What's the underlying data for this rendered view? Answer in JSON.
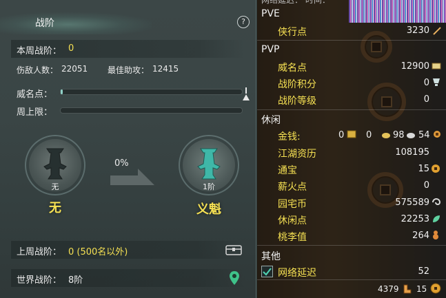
{
  "left_panel": {
    "title": "战阶",
    "help_label": "?",
    "weekly_rank_label": "本周战阶：",
    "weekly_rank_value": "0",
    "kills_label": "伤敌人数：",
    "kills_value": "22051",
    "best_assist_label": "最佳助攻：",
    "best_assist_value": "12415",
    "prestige_label": "威名点：",
    "prestige_progress": 0.01,
    "weekly_cap_label": "周上限：",
    "weekly_cap_progress": 0,
    "current_rank": {
      "level": "无",
      "name": "无"
    },
    "progress_percent": "0%",
    "next_rank": {
      "level": "1阶",
      "name": "义魁"
    },
    "last_week_label": "上周战阶：",
    "last_week_value": "0 (500名以外)",
    "world_rank_label": "世界战阶：",
    "world_rank_value": "8阶"
  },
  "right_panel": {
    "topbar": {
      "partial_text": "网络延迟： 时间："
    },
    "pve": {
      "title": "PVE",
      "items": [
        {
          "label": "侠行点",
          "value": "3230"
        }
      ]
    },
    "pvp": {
      "title": "PVP",
      "items": [
        {
          "label": "威名点",
          "value": "12900"
        },
        {
          "label": "战阶积分",
          "value": "0"
        },
        {
          "label": "战阶等级",
          "value": "0"
        }
      ]
    },
    "leisure": {
      "title": "休闲",
      "money": {
        "label": "金钱:",
        "gold": "0",
        "silver": "0",
        "copper_a": "98",
        "copper_b": "54"
      },
      "items": [
        {
          "label": "江湖资历",
          "value": "108195"
        },
        {
          "label": "通宝",
          "value": "15"
        },
        {
          "label": "薪火点",
          "value": "0"
        },
        {
          "label": "园宅币",
          "value": "575589"
        },
        {
          "label": "休闲点",
          "value": "22253"
        },
        {
          "label": "桃李值",
          "value": "264"
        }
      ]
    },
    "other": {
      "title": "其他",
      "network_label": "网络延迟",
      "network_value": "52",
      "network_checked": true
    },
    "footer": {
      "points": "4379",
      "tongbao": "15"
    }
  },
  "colors": {
    "accent_yellow": "#f6e153",
    "progress_teal": "#8fd0c6"
  }
}
